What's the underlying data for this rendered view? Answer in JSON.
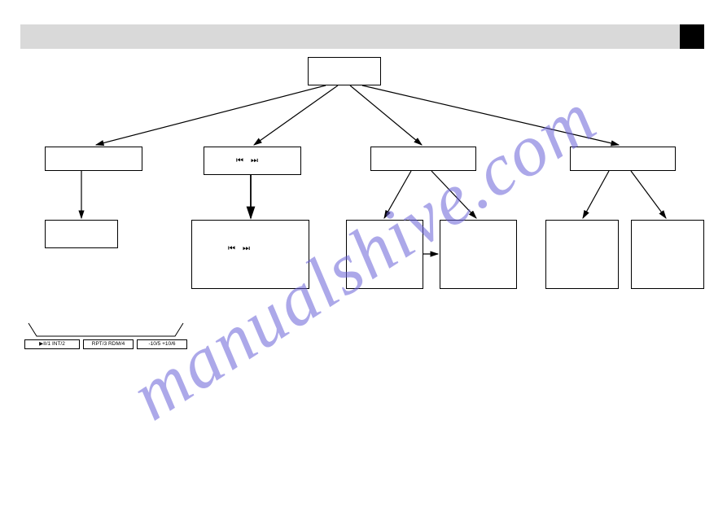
{
  "watermark": "manualshive.com",
  "icons": {
    "prev": "⏮",
    "next": "⏭"
  },
  "remote": {
    "buttons": [
      "▶II/1   INT/2",
      "RPT/3  RDM/4",
      "-10/5   +10/6"
    ]
  },
  "boxes": {
    "root": "",
    "l1a": "",
    "l1b": "",
    "l1c": "",
    "l1d": "",
    "l2a": "",
    "l2b": "",
    "l2c": "",
    "l2d": "",
    "l2e": "",
    "l2f": ""
  }
}
